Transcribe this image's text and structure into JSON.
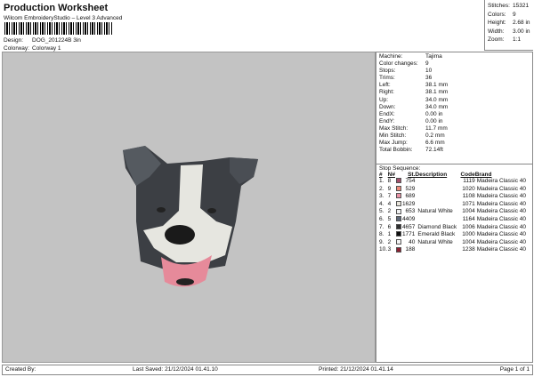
{
  "header": {
    "title": "Production Worksheet",
    "subtitle": "Wilcom EmbroideryStudio – Level 3 Advanced",
    "design_label": "Design:",
    "design": "DOG_201224B 3in",
    "colorway_label": "Colorway:",
    "colorway": "Colorway 1"
  },
  "summary": [
    {
      "k": "Stitches:",
      "v": "15321"
    },
    {
      "k": "Colors:",
      "v": "9"
    },
    {
      "k": "Height:",
      "v": "2.68 in"
    },
    {
      "k": "Width:",
      "v": "3.00 in"
    },
    {
      "k": "Zoom:",
      "v": "1:1"
    }
  ],
  "stats": [
    {
      "k": "Machine:",
      "v": "Tajima"
    },
    {
      "k": "Color changes:",
      "v": "9"
    },
    {
      "k": "Stops:",
      "v": "10"
    },
    {
      "k": "Trims:",
      "v": "36"
    },
    {
      "k": "Left:",
      "v": "38.1 mm"
    },
    {
      "k": "Right:",
      "v": "38.1 mm"
    },
    {
      "k": "Up:",
      "v": "34.0 mm"
    },
    {
      "k": "Down:",
      "v": "34.0 mm"
    },
    {
      "k": "EndX:",
      "v": "0.00 in"
    },
    {
      "k": "EndY:",
      "v": "0.00 in"
    },
    {
      "k": "Max Stitch:",
      "v": "11.7 mm"
    },
    {
      "k": "Min Stitch:",
      "v": "0.2 mm"
    },
    {
      "k": "Max Jump:",
      "v": "6.6 mm"
    },
    {
      "k": "Total Bobbin:",
      "v": "72.14ft"
    }
  ],
  "sequence": {
    "title": "Stop Sequence:",
    "headers": [
      "#",
      "N#",
      "St.",
      "Description",
      "Code",
      "Brand"
    ],
    "rows": [
      {
        "i": "1.",
        "n": "8",
        "color": "#a24f6b",
        "st": "754",
        "desc": "",
        "code": "1119",
        "brand": "Madeira Classic 40"
      },
      {
        "i": "2.",
        "n": "9",
        "color": "#f08a7a",
        "st": "529",
        "desc": "",
        "code": "1020",
        "brand": "Madeira Classic 40"
      },
      {
        "i": "3.",
        "n": "7",
        "color": "#ea93a6",
        "st": "689",
        "desc": "",
        "code": "1108",
        "brand": "Madeira Classic 40"
      },
      {
        "i": "4.",
        "n": "4",
        "color": "#e8e4da",
        "st": "1629",
        "desc": "",
        "code": "1071",
        "brand": "Madeira Classic 40"
      },
      {
        "i": "5.",
        "n": "2",
        "color": "#f2f2f2",
        "st": "653",
        "desc": "Natural White",
        "code": "1004",
        "brand": "Madeira Classic 40"
      },
      {
        "i": "6.",
        "n": "5",
        "color": "#5f6878",
        "st": "4409",
        "desc": "",
        "code": "1164",
        "brand": "Madeira Classic 40"
      },
      {
        "i": "7.",
        "n": "6",
        "color": "#2f2f2f",
        "st": "4657",
        "desc": "Diamond Black",
        "code": "1006",
        "brand": "Madeira Classic 40"
      },
      {
        "i": "8.",
        "n": "1",
        "color": "#0e0e0e",
        "st": "1771",
        "desc": "Emerald Black",
        "code": "1000",
        "brand": "Madeira Classic 40"
      },
      {
        "i": "9.",
        "n": "2",
        "color": "#f4f4f4",
        "st": "40",
        "desc": "Natural White",
        "code": "1004",
        "brand": "Madeira Classic 40"
      },
      {
        "i": "10.",
        "n": "3",
        "color": "#8b2131",
        "st": "188",
        "desc": "",
        "code": "1238",
        "brand": "Madeira Classic 40"
      }
    ]
  },
  "footer": {
    "created": "Created By:",
    "saved": "Last Saved: 21/12/2024 01.41.10",
    "printed": "Printed: 21/12/2024 01.41.14",
    "page": "Page 1 of 1"
  }
}
